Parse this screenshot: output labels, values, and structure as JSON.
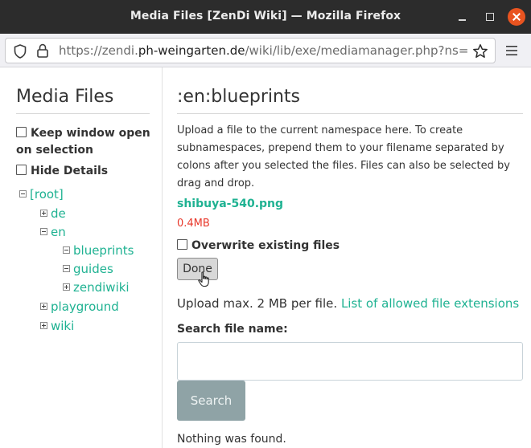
{
  "window": {
    "title": "Media Files [ZenDi Wiki] — Mozilla Firefox"
  },
  "navbar": {
    "url_prefix": "https://zendi.",
    "url_host": "ph-weingarten.de",
    "url_path": "/wiki/lib/exe/mediamanager.php?ns="
  },
  "sidebar": {
    "title": "Media Files",
    "keep_window_open_line1": "Keep window open",
    "keep_window_open_line2": "on selection",
    "hide_details": "Hide Details",
    "tree": [
      {
        "label": "[root]",
        "state": "minus"
      },
      {
        "label": "de",
        "state": "plus"
      },
      {
        "label": "en",
        "state": "minus"
      },
      {
        "label": "blueprints",
        "state": "minus"
      },
      {
        "label": "guides",
        "state": "minus"
      },
      {
        "label": "zendiwiki",
        "state": "plus"
      },
      {
        "label": "playground",
        "state": "plus"
      },
      {
        "label": "wiki",
        "state": "plus"
      }
    ]
  },
  "main": {
    "title": ":en:blueprints",
    "intro": "Upload a file to the current namespace here. To create subnamespaces, prepend them to your filename separated by colons after you selected the files. Files can also be selected by drag and drop.",
    "file_name": "shibuya-540.png",
    "file_size": "0.4MB",
    "overwrite_label": "Overwrite existing files",
    "done_label": "Done",
    "upload_limit": "Upload max. 2 MB per file.",
    "allowed_ext_link": "List of allowed file extensions",
    "search_label": "Search file name:",
    "search_value": "",
    "search_button": "Search",
    "no_results": "Nothing was found."
  },
  "colors": {
    "link": "#1fb292",
    "error": "#e8372a",
    "titlebar": "#2c2c2c",
    "close_button": "#e95420",
    "search_button": "#8fa3a6"
  }
}
